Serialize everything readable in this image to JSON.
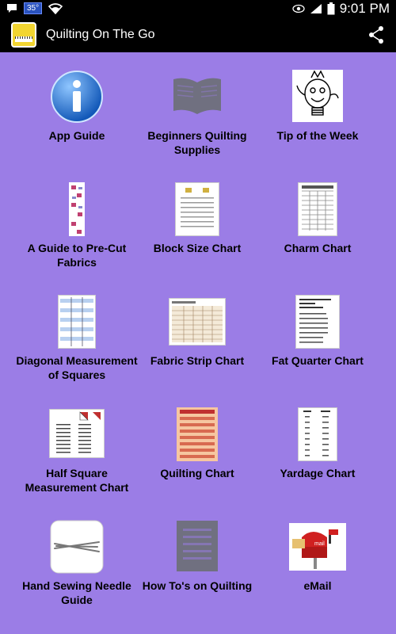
{
  "status_bar": {
    "temperature": "35°",
    "time": "9:01 PM"
  },
  "app_bar": {
    "title": "Quilting On The Go"
  },
  "items": [
    {
      "label": "App Guide",
      "icon": "info-icon"
    },
    {
      "label": "Beginners Quilting Supplies",
      "icon": "book-icon"
    },
    {
      "label": "Tip of the Week",
      "icon": "lightbulb-character-icon"
    },
    {
      "label": "A Guide to Pre-Cut Fabrics",
      "icon": "fabric-strip-thumbnail"
    },
    {
      "label": "Block Size Chart",
      "icon": "block-size-chart-thumbnail"
    },
    {
      "label": "Charm Chart",
      "icon": "charm-chart-thumbnail"
    },
    {
      "label": "Diagonal Measurement of Squares",
      "icon": "diagonal-chart-thumbnail"
    },
    {
      "label": "Fabric Strip Chart",
      "icon": "fabric-strip-chart-thumbnail"
    },
    {
      "label": "Fat Quarter Chart",
      "icon": "fat-quarter-chart-thumbnail"
    },
    {
      "label": "Half Square Measurement Chart",
      "icon": "half-square-chart-thumbnail"
    },
    {
      "label": "Quilting Chart",
      "icon": "quilting-chart-thumbnail"
    },
    {
      "label": "Yardage Chart",
      "icon": "yardage-chart-thumbnail"
    },
    {
      "label": "Hand Sewing Needle Guide",
      "icon": "needles-icon"
    },
    {
      "label": "How To's on Quilting",
      "icon": "list-icon"
    },
    {
      "label": "eMail",
      "icon": "mailbox-icon"
    }
  ],
  "colors": {
    "background": "#9b7de6",
    "status_bar": "#000000",
    "info_blue": "#1a6fd6"
  }
}
